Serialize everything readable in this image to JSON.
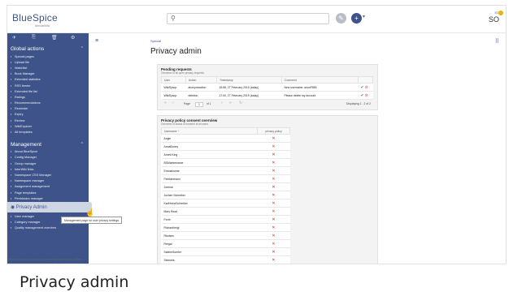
{
  "header": {
    "logo": "BlueSpice",
    "logo_sub": "MediaWiki",
    "search_icon": "search-icon",
    "user_initials": "SO",
    "user_tiny": "ED"
  },
  "sidebar": {
    "tools": [
      "✈",
      "⎘",
      "🗑",
      "⚙"
    ],
    "global_actions_heading": "Global actions",
    "global_items": [
      "Special pages",
      "Upload file",
      "Watchlist",
      "Book Manager",
      "Extended statistics",
      "RSS feeder",
      "Extended file list",
      "Ratings",
      "Recommendations",
      "Reminder",
      "Expiry",
      "Review",
      "WikiExplorer",
      "All templates"
    ],
    "management_heading": "Management",
    "management_items": [
      "About BlueSpice",
      "Config Manager",
      "Group manager",
      "InterWiki links",
      "Namespace CSS Manager",
      "Namespace manager",
      "Assignment management",
      "Page templates",
      "Permission manager"
    ],
    "active_item": "Privacy Admin",
    "after_items": [
      "User manager",
      "Category manager",
      "Quality management overview"
    ],
    "tooltip": "Management page for user privacy settings"
  },
  "main": {
    "breadcrumb": "Special",
    "title": "Privacy admin",
    "pending": {
      "title": "Pending requests",
      "subtitle": "Overview of all open privacy requests",
      "columns": [
        "User",
        "Action",
        "Timestamp",
        "Comment"
      ],
      "rows": [
        [
          "WikiSysop",
          "anonymization",
          "16:58, 27 February 2019 (today)",
          "New username: anonF685"
        ],
        [
          "WikiSysop",
          "deletion",
          "17:00, 27 February 2019 (today)",
          "Please delete my account"
        ]
      ],
      "pager_label": "Page",
      "page": "1",
      "of_label": "of 1",
      "displaying": "Displaying 1 - 2 of 2"
    },
    "consent": {
      "title": "Privacy policy consent overview",
      "subtitle": "Overview of status of consent of all users",
      "columns": [
        "Username",
        "privacy policy"
      ],
      "users": [
        "Angie",
        "AnnaBonny",
        "Arnett King",
        "BSMaintenance",
        "Emmakumar",
        "Fleekimmann",
        "Joernal",
        "Jochen Schreiber",
        "KarlHeinzSchreiber",
        "Mary Read",
        "Porth",
        "Richardheigl",
        "Rbolsen",
        "Rregal",
        "SabineSuerter",
        "Sidosela"
      ]
    }
  },
  "statusbar": "https://en.demo.bluespice.com/wiki/Special:Privacy_Admin",
  "caption": "Privacy admin"
}
